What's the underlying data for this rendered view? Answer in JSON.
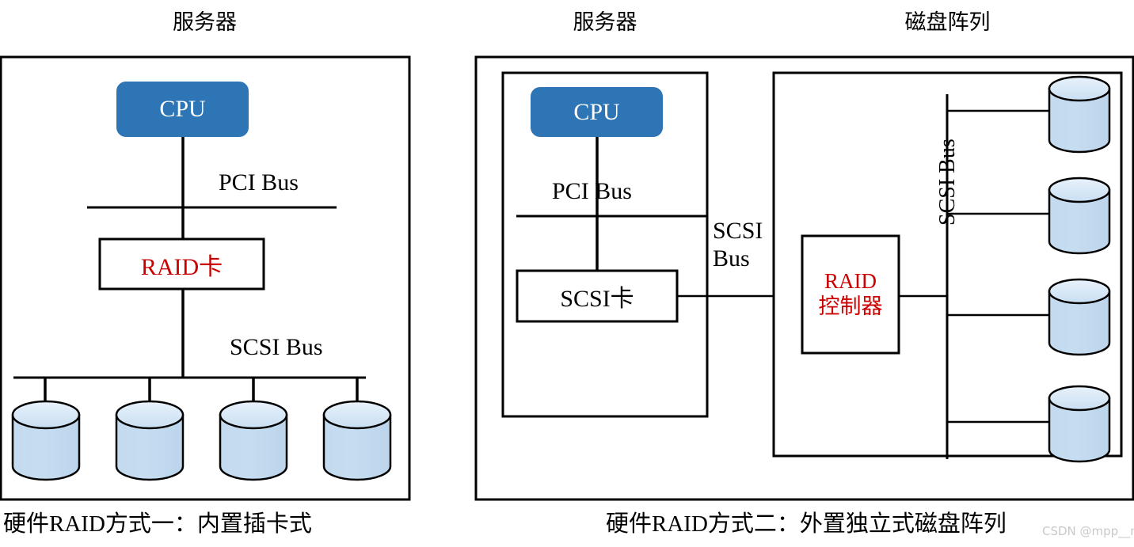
{
  "figure": {
    "type": "diagram",
    "subject": "Hardware RAID implementation comparison",
    "watermark": "CSDN @mpp__mvp"
  },
  "panels": [
    {
      "id": "panel-left",
      "title": "服务器",
      "caption": "硬件RAID方式一：内置插卡式",
      "nodes": {
        "cpu": "CPU",
        "raid_card": "RAID卡"
      },
      "buses": {
        "pci": "PCI Bus",
        "scsi": "SCSI Bus"
      },
      "disk_count": 4
    },
    {
      "id": "panel-right",
      "titles": {
        "server": "服务器",
        "array": "磁盘阵列"
      },
      "caption": "硬件RAID方式二：外置独立式磁盘阵列",
      "nodes": {
        "cpu": "CPU",
        "scsi_card": "SCSI卡",
        "raid_controller_line1": "RAID",
        "raid_controller_line2": "控制器"
      },
      "buses": {
        "pci": "PCI Bus",
        "scsi_interconnect_line1": "SCSI",
        "scsi_interconnect_line2": "Bus",
        "scsi_array": "SCSI Bus"
      },
      "disk_count": 4
    }
  ],
  "colors": {
    "cpu_fill": "#2E75B6",
    "cpu_text": "#ffffff",
    "disk_fill": "#BDD7EE",
    "disk_top_fill": "#D6E6F5",
    "stroke": "#000000",
    "red_text": "#cc0000",
    "watermark": "#c9c9c9"
  }
}
